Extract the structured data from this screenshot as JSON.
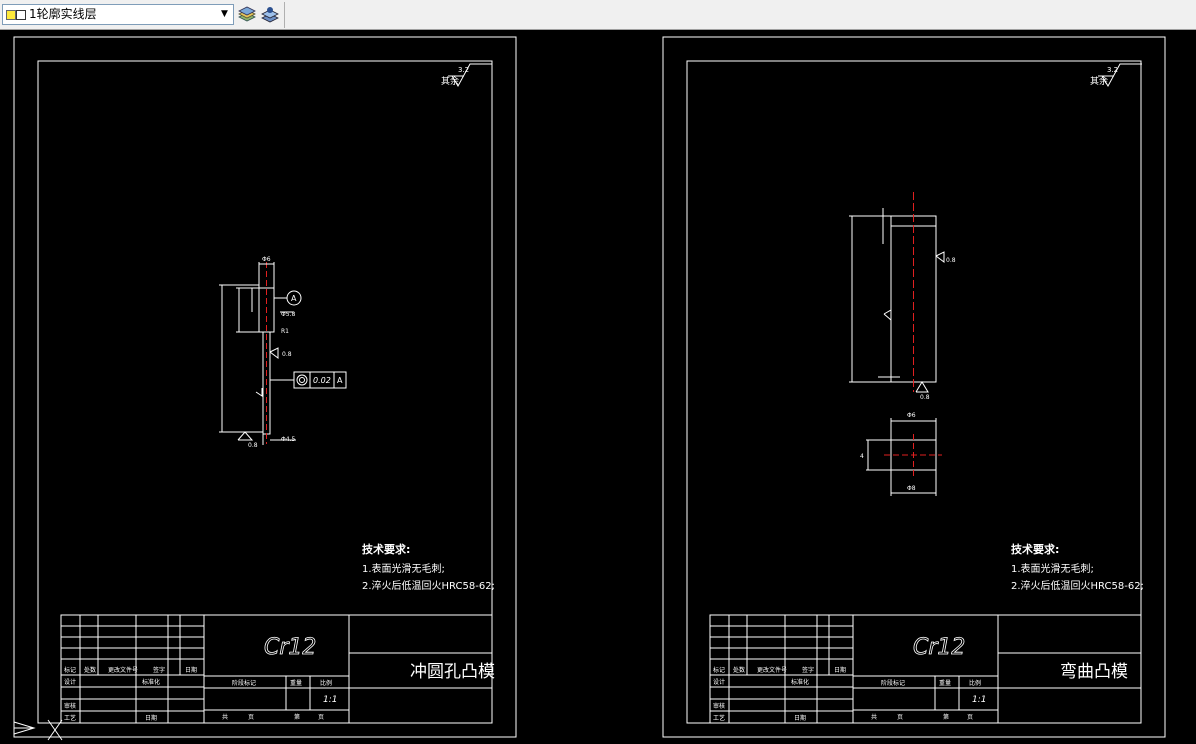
{
  "toolbar": {
    "layer_name": "1轮廓实线层",
    "dropdown_arrow": "▼",
    "icons": [
      "layer-manager-icon",
      "layer-states-icon"
    ]
  },
  "sheet_left": {
    "roughness_label": "其余",
    "roughness_value": "3.2",
    "tech_title": "技术要求:",
    "tech_line1": "1.表面光滑无毛刺;",
    "tech_line2": "2.淬火后低温回火HRC58-62;",
    "material": "Cr12",
    "part_name": "冲圆孔凸模",
    "scale": "1:1",
    "datum": "A",
    "tolerance_value": "0.02",
    "tolerance_datum": "A",
    "title_labels": {
      "mark": "标记",
      "count": "处数",
      "file_no": "更改文件号",
      "sign": "签字",
      "date": "日期",
      "design": "设计",
      "standard": "标准化",
      "review": "审核",
      "process": "工艺",
      "date2": "日期",
      "stage": "阶段标记",
      "weight": "重量",
      "ratio": "比例",
      "total": "共",
      "page": "页",
      "sheet": "第",
      "sheet_page": "页"
    }
  },
  "sheet_right": {
    "roughness_label": "其余",
    "roughness_value": "3.2",
    "tech_title": "技术要求:",
    "tech_line1": "1.表面光滑无毛刺;",
    "tech_line2": "2.淬火后低温回火HRC58-62;",
    "material": "Cr12",
    "part_name": "弯曲凸模",
    "scale": "1:1",
    "title_labels": {
      "mark": "标记",
      "count": "处数",
      "file_no": "更改文件号",
      "sign": "签字",
      "date": "日期",
      "design": "设计",
      "standard": "标准化",
      "review": "审核",
      "process": "工艺",
      "date2": "日期",
      "stage": "阶段标记",
      "weight": "重量",
      "ratio": "比例",
      "total": "共",
      "page": "页",
      "sheet": "第",
      "sheet_page": "页"
    }
  },
  "colors": {
    "background": "#000000",
    "line": "#ffffff",
    "centerline": "#e02020"
  }
}
